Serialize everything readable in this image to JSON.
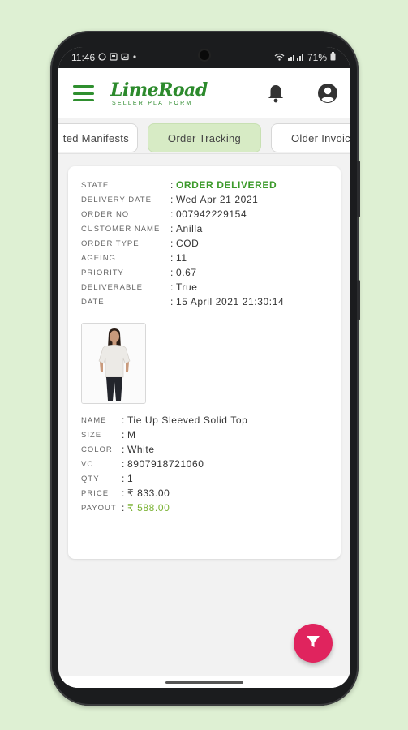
{
  "status_bar": {
    "time": "11:46",
    "left_icons": [
      "whatsapp-icon",
      "notification-icon",
      "image-icon",
      "dot-icon"
    ],
    "right_icons": [
      "wifi-icon",
      "signal-icon",
      "battery-icon"
    ],
    "battery": "71%"
  },
  "app_bar": {
    "brand_name": "LimeRoad",
    "brand_subtitle": "SELLER PLATFORM",
    "icons": [
      "menu-icon",
      "bell-icon",
      "account-icon"
    ]
  },
  "tabs": [
    {
      "label": "ted Manifests",
      "active": false
    },
    {
      "label": "Order Tracking",
      "active": true
    },
    {
      "label": "Older Invoic",
      "active": false
    }
  ],
  "order": {
    "fields": [
      {
        "label": "STATE",
        "value": "ORDER DELIVERED"
      },
      {
        "label": "DELIVERY DATE",
        "value": "Wed Apr 21 2021"
      },
      {
        "label": "ORDER NO",
        "value": "007942229154"
      },
      {
        "label": "CUSTOMER NAME",
        "value": "Anilla"
      },
      {
        "label": "ORDER TYPE",
        "value": "COD"
      },
      {
        "label": "AGEING",
        "value": "11"
      },
      {
        "label": "PRIORITY",
        "value": "0.67"
      },
      {
        "label": "DELIVERABLE",
        "value": "True"
      },
      {
        "label": "DATE",
        "value": "15 April 2021 21:30:14"
      }
    ],
    "separator": ":"
  },
  "item": {
    "fields": [
      {
        "label": "NAME",
        "value": "Tie Up Sleeved Solid Top"
      },
      {
        "label": "SIZE",
        "value": "M"
      },
      {
        "label": "COLOR",
        "value": "White"
      },
      {
        "label": "VC",
        "value": "8907918721060"
      },
      {
        "label": "QTY",
        "value": "1"
      },
      {
        "label": "PRICE",
        "value": "₹ 833.00"
      },
      {
        "label": "PAYOUT",
        "value": "₹ 588.00"
      }
    ]
  },
  "fab": {
    "icon": "filter-icon"
  },
  "colors": {
    "brand_green": "#2c8a2c",
    "state_green": "#3c9a2b",
    "payout_green": "#7ab233",
    "fab_pink": "#e0245e",
    "active_tab": "#d7ebc5",
    "background": "#def0d3"
  }
}
